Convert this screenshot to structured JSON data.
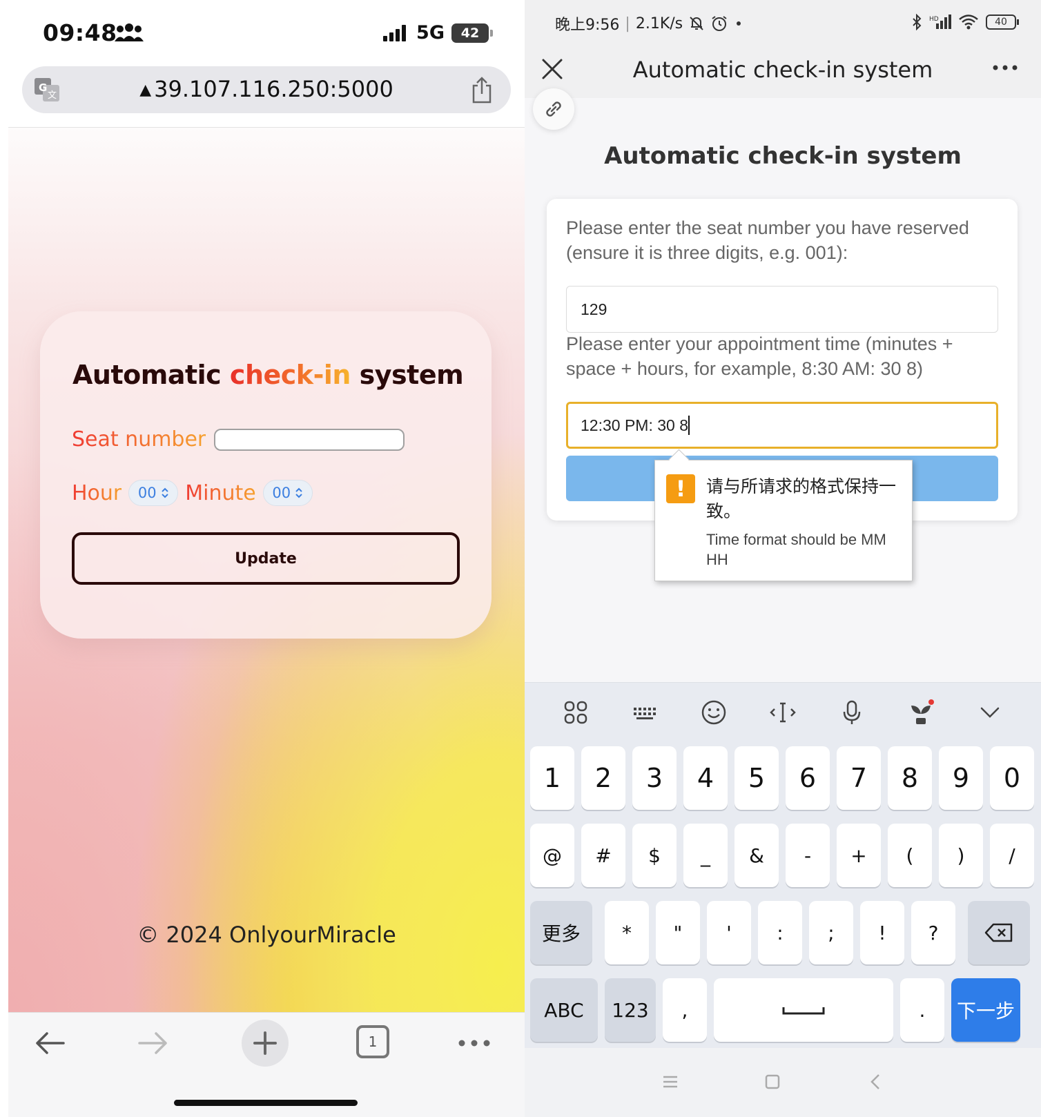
{
  "left": {
    "status": {
      "time": "09:48",
      "network": "5G",
      "battery": "42"
    },
    "url": "39.107.116.250:5000",
    "card": {
      "title_part1": "Automatic ",
      "title_highlight": "check-in",
      "title_part2": " system",
      "seat_label": "Seat number",
      "seat_value": "",
      "hour_label": "Hour",
      "hour_value": "00",
      "minute_label": "Minute",
      "minute_value": "00",
      "update_label": "Update"
    },
    "footer": "© 2024 OnlyourMiracle",
    "toolbar": {
      "tabs_count": "1"
    },
    "colors": {
      "title_dark": "#2a0a0a",
      "highlight_start": "#e8302a",
      "highlight_end": "#f7b42c",
      "spin_text": "#3c7fe0"
    }
  },
  "right": {
    "status": {
      "time": "晚上9:56",
      "speed": "2.1K/s",
      "battery": "40"
    },
    "header": {
      "title": "Automatic check-in system"
    },
    "page_title": "Automatic check-in system",
    "seat_label": "Please enter the seat number you have reserved (ensure it is three digits, e.g. 001):",
    "seat_value": "129",
    "time_label": "Please enter your appointment time (minutes + space + hours, for example, 8:30 AM: 30 8)",
    "time_value": "12:30 PM: 30 8",
    "tooltip": {
      "icon": "!",
      "message": "请与所请求的格式保持一致。",
      "detail": "Time format should be MM HH"
    },
    "keyboard": {
      "row1": [
        "1",
        "2",
        "3",
        "4",
        "5",
        "6",
        "7",
        "8",
        "9",
        "0"
      ],
      "row2": [
        "@",
        "#",
        "$",
        "_",
        "&",
        "-",
        "+",
        "(",
        ")",
        "/"
      ],
      "row3": [
        "更多",
        "*",
        "\"",
        "'",
        ":",
        ";",
        "!",
        "?"
      ],
      "row4": [
        "ABC",
        "123",
        ",",
        "",
        ".",
        "下一步"
      ]
    },
    "colors": {
      "input_focus": "#e8b02a",
      "submit": "#7ab7ec",
      "warn": "#f59c12",
      "next_key": "#2e7de9"
    }
  }
}
